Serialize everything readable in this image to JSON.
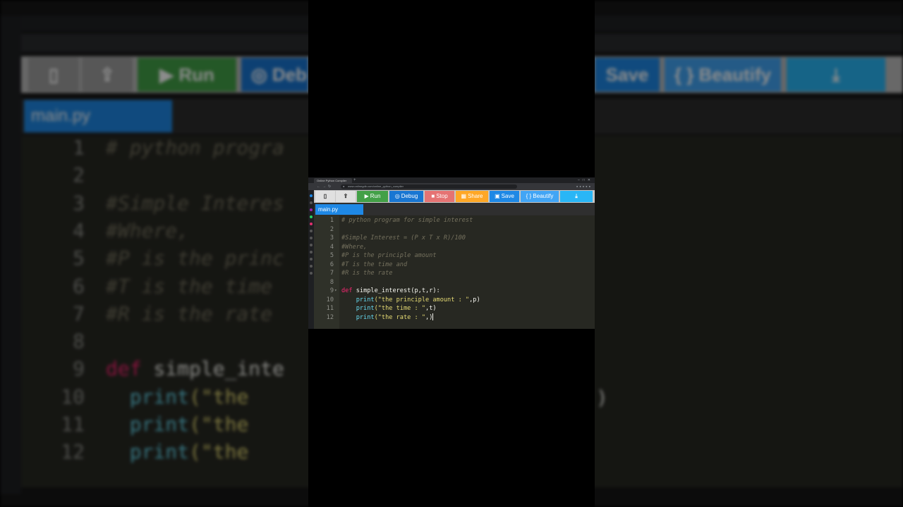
{
  "browser": {
    "tab_title": "Online Python Compiler",
    "url": "www.onlinegdb.com/online_python_compiler"
  },
  "toolbar": {
    "run_label": "Run",
    "debug_label": "Debug",
    "stop_label": "Stop",
    "share_label": "Share",
    "save_label": "Save",
    "beautify_label": "{ } Beautify",
    "colors": {
      "run": "#43a047",
      "debug": "#1976d2",
      "stop": "#e57373",
      "share": "#ffa726",
      "save": "#1e88e5",
      "beautify": "#42a5f5",
      "download": "#29b6f6"
    },
    "icons": {
      "new_file": "file-icon",
      "upload": "upload-icon",
      "run": "play-icon",
      "debug": "debug-icon",
      "stop": "stop-icon",
      "share": "share-icon",
      "save": "floppy-icon",
      "download": "download-icon"
    }
  },
  "file_tab": {
    "name": "main.py"
  },
  "editor": {
    "lines": [
      {
        "n": "1",
        "text": "# python program for simple interest"
      },
      {
        "n": "2",
        "text": ""
      },
      {
        "n": "3",
        "text": "#Simple Interest = (P x T x R)/100"
      },
      {
        "n": "4",
        "text": "#Where,"
      },
      {
        "n": "5",
        "text": "#P is the principle amount"
      },
      {
        "n": "6",
        "text": "#T is the time and"
      },
      {
        "n": "7",
        "text": "#R is the rate"
      },
      {
        "n": "8",
        "text": ""
      },
      {
        "n": "9",
        "kw": "def",
        "fn": "simple_interest",
        "rest": "(p,t,r):"
      },
      {
        "n": "10",
        "indent": "    ",
        "call": "print",
        "str": "(\"the principle amount : \"",
        "rest": ",p)"
      },
      {
        "n": "11",
        "indent": "    ",
        "call": "print",
        "str": "(\"the time : \"",
        "rest": ",t)"
      },
      {
        "n": "12",
        "indent": "    ",
        "call": "print",
        "str": "(\"the rate : \"",
        "rest": ",)"
      }
    ]
  },
  "background": {
    "file_name": "main.py",
    "run_label": "Run",
    "debug_label": "Deb",
    "save_label": "Save",
    "beautify_label": "{ } Beautify",
    "lines": [
      {
        "n": "1",
        "text": "# python progra"
      },
      {
        "n": "2",
        "text": ""
      },
      {
        "n": "3",
        "text": "#Simple Interes"
      },
      {
        "n": "4",
        "text": "#Where,"
      },
      {
        "n": "5",
        "text": "#P is the princ"
      },
      {
        "n": "6",
        "text": "#T is the time"
      },
      {
        "n": "7",
        "text": "#R is the rate"
      },
      {
        "n": "8",
        "text": ""
      },
      {
        "n": "9",
        "kw": "def",
        "fn": "simple_inte"
      },
      {
        "n": "10",
        "call": "print",
        "str": "(\"the"
      },
      {
        "n": "11",
        "call": "print",
        "str": "(\"the"
      },
      {
        "n": "12",
        "call": "print",
        "str": "(\"the"
      }
    ],
    "right_tail": ")"
  }
}
